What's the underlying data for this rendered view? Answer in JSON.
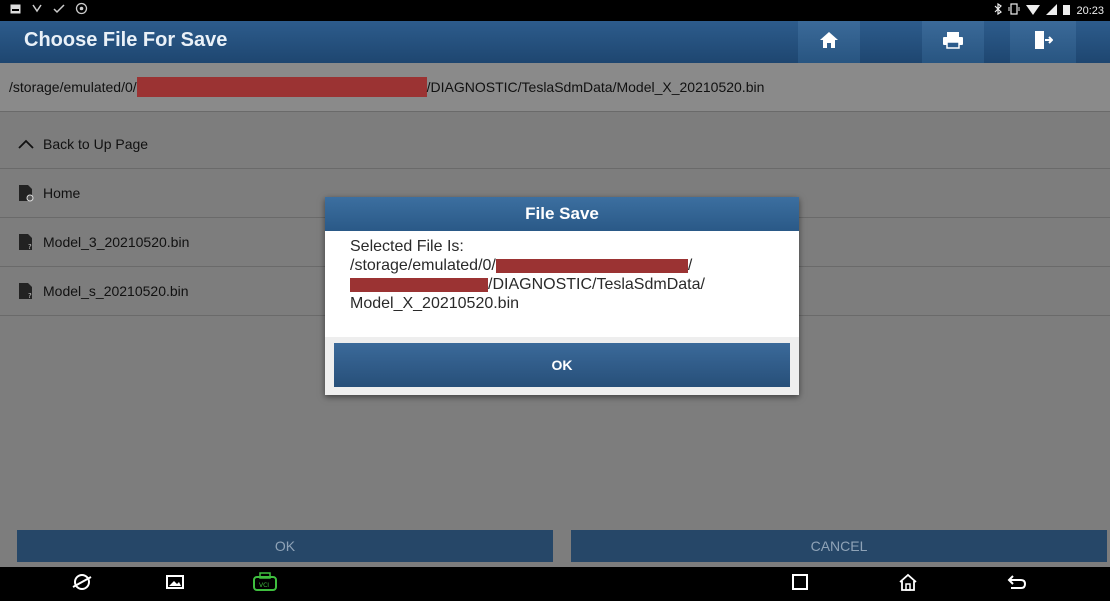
{
  "status_bar": {
    "left_icons": [
      "notification-icon",
      "usb-icon",
      "check-icon",
      "settings-icon"
    ],
    "right_icons": [
      "bluetooth-icon",
      "vibrate-icon",
      "wifi-icon",
      "signal-icon",
      "battery-icon"
    ],
    "time": "20:23"
  },
  "header": {
    "title": "Choose File For Save",
    "buttons": [
      "home-icon",
      "print-icon",
      "exit-icon"
    ]
  },
  "path_bar": {
    "prefix": "/storage/emulated/0/",
    "suffix": "/DIAGNOSTIC/TeslaSdmData/Model_X_20210520.bin"
  },
  "list": {
    "back_label": "Back to Up Page",
    "items": [
      {
        "label": "Home",
        "icon": "folder-settings-icon"
      },
      {
        "label": "Model_3_20210520.bin",
        "icon": "file-icon"
      },
      {
        "label": "Model_s_20210520.bin",
        "icon": "file-icon"
      }
    ]
  },
  "footer_buttons": {
    "ok": "OK",
    "cancel": "CANCEL"
  },
  "dialog": {
    "title": "File Save",
    "line1": "Selected File Is:",
    "line2_prefix": "/storage/emulated/0/",
    "line2_suffix": "/",
    "line3_suffix": "/DIAGNOSTIC/TeslaSdmData/",
    "line4": "Model_X_20210520.bin",
    "ok_label": "OK"
  },
  "nav_bar": {
    "items": [
      "browser-icon",
      "gallery-icon",
      "vci-icon",
      "recents-icon",
      "home-nav-icon",
      "back-icon"
    ]
  },
  "colors": {
    "header_blue": "#2d5c8c",
    "button_blue": "#274f79",
    "redaction": "#9b3333",
    "vci_green": "#3fbf3f"
  }
}
